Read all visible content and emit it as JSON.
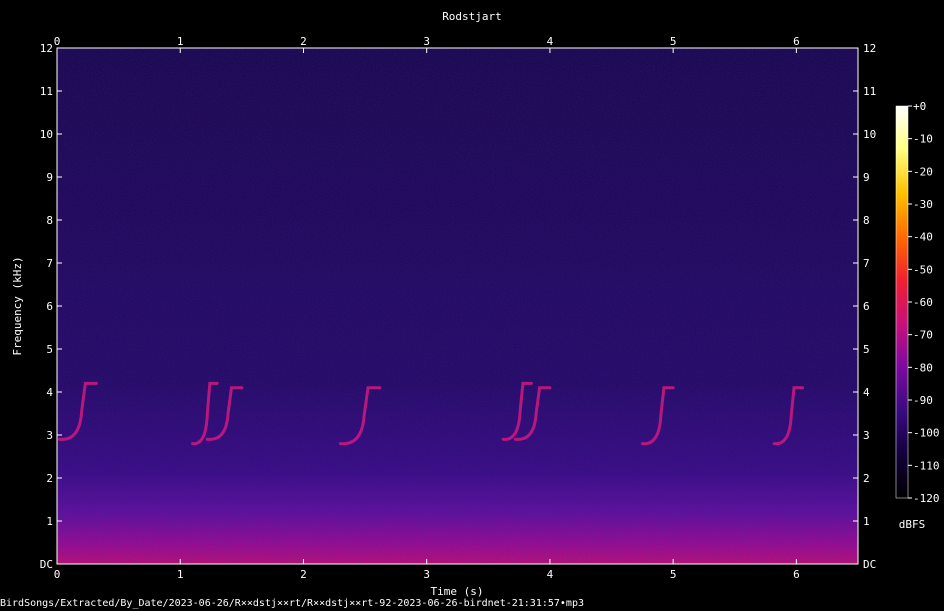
{
  "chart_data": {
    "type": "heatmap",
    "title": "Rodstjart",
    "xlabel": "Time (s)",
    "ylabel": "Frequency (kHz)",
    "xlim": [
      0,
      6.5
    ],
    "ylim": [
      0,
      12
    ],
    "x_ticks": [
      "0",
      "1",
      "2",
      "3",
      "4",
      "5",
      "6"
    ],
    "y_ticks": [
      "DC",
      "1",
      "2",
      "3",
      "4",
      "5",
      "6",
      "7",
      "8",
      "9",
      "10",
      "11",
      "12"
    ],
    "colorbar": {
      "label": "dBFS",
      "range": [
        -120,
        0
      ],
      "ticks": [
        "+0",
        "-10",
        "-20",
        "-30",
        "-40",
        "-50",
        "-60",
        "-70",
        "-80",
        "-90",
        "-100",
        "-110",
        "-120"
      ],
      "colors": [
        "#000000",
        "#12003a",
        "#3a0a80",
        "#7a0aa0",
        "#c8107a",
        "#f02030",
        "#ff6a00",
        "#ffc000",
        "#ffff80",
        "#ffffff"
      ]
    },
    "calls": [
      {
        "t_start": 0.02,
        "t_end": 0.32,
        "f_low": 2.9,
        "f_high": 4.2
      },
      {
        "t_start": 1.1,
        "t_end": 1.3,
        "f_low": 2.8,
        "f_high": 4.2
      },
      {
        "t_start": 1.22,
        "t_end": 1.5,
        "f_low": 2.9,
        "f_high": 4.1
      },
      {
        "t_start": 2.3,
        "t_end": 2.62,
        "f_low": 2.8,
        "f_high": 4.1
      },
      {
        "t_start": 3.62,
        "t_end": 3.85,
        "f_low": 2.9,
        "f_high": 4.2
      },
      {
        "t_start": 3.72,
        "t_end": 4.0,
        "f_low": 2.9,
        "f_high": 4.1
      },
      {
        "t_start": 4.75,
        "t_end": 5.0,
        "f_low": 2.8,
        "f_high": 4.1
      },
      {
        "t_start": 5.82,
        "t_end": 6.05,
        "f_low": 2.8,
        "f_high": 4.1
      }
    ]
  },
  "footer": {
    "path": "BirdSongs/Extracted/By_Date/2023-06-26/R××dstj××rt/R××dstj××rt-92-2023-06-26-birdnet-21:31:57•mp3"
  }
}
